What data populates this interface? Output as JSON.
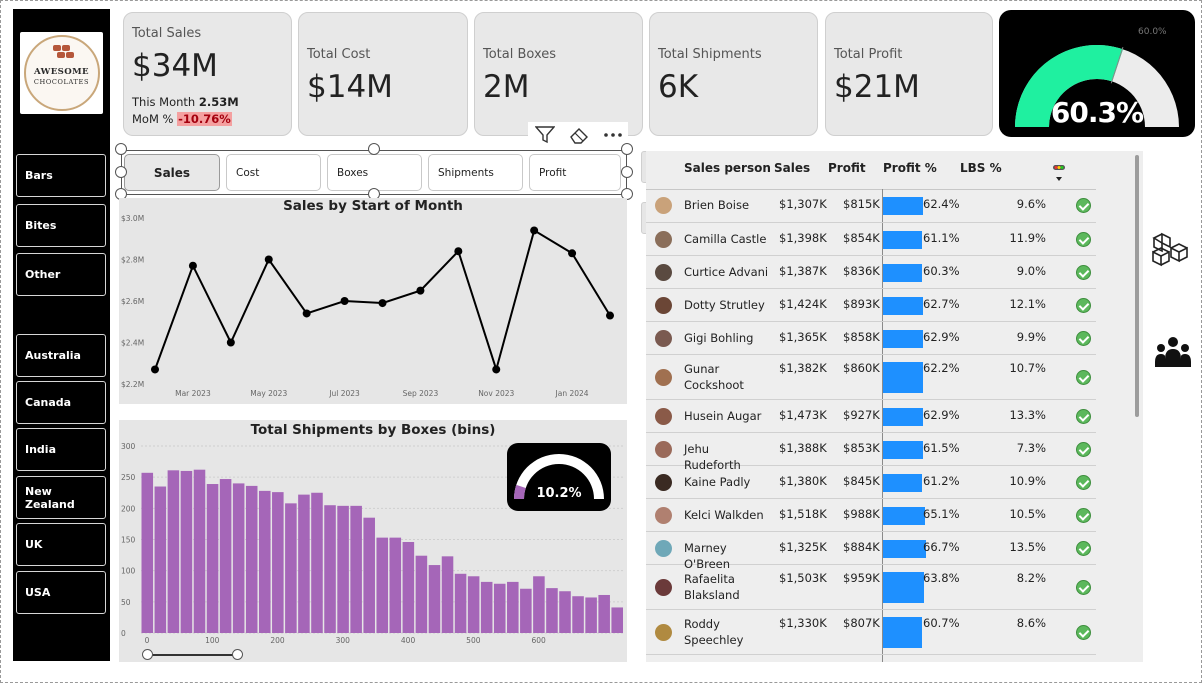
{
  "logo": {
    "line1": "AWESOME",
    "line2": "CHOCOLATES"
  },
  "sidebar": {
    "categories": [
      "Bars",
      "Bites",
      "Other"
    ],
    "countries": [
      "Australia",
      "Canada",
      "India",
      "New Zealand",
      "UK",
      "USA"
    ]
  },
  "kpis": {
    "sales": {
      "title": "Total Sales",
      "value": "$34M",
      "this_month_label": "This Month",
      "this_month_value": "2.53M",
      "mom_label": "MoM %",
      "mom_value": "-10.76%"
    },
    "cost": {
      "title": "Total Cost",
      "value": "$14M"
    },
    "boxes": {
      "title": "Total Boxes",
      "value": "2M"
    },
    "shipments": {
      "title": "Total Shipments",
      "value": "6K"
    },
    "profit": {
      "title": "Total Profit",
      "value": "$21M"
    }
  },
  "gauge": {
    "value_label": "60.3%",
    "target_label": "60.0%",
    "value": 60.3,
    "target": 60.0,
    "fill_color": "#1ff0a0",
    "track_color": "#ececec"
  },
  "slicer": {
    "tabs": [
      "Sales",
      "Cost",
      "Boxes",
      "Shipments",
      "Profit"
    ],
    "selected": "Sales"
  },
  "colors": {
    "line": "#000000",
    "bars": "#a566b8",
    "profit_bar": "#1e90ff",
    "mom_negative": "#f4a0a0",
    "check": "#5cb85c"
  },
  "line_chart": {
    "chart_data": {
      "type": "line",
      "title": "Sales by Start of Month",
      "x": [
        "2023-02",
        "2023-03",
        "2023-04",
        "2023-05",
        "2023-06",
        "2023-07",
        "2023-08",
        "2023-09",
        "2023-10",
        "2023-11",
        "2023-12",
        "2024-01",
        "2024-02"
      ],
      "values": [
        2.27,
        2.77,
        2.4,
        2.8,
        2.54,
        2.6,
        2.59,
        2.65,
        2.84,
        2.27,
        2.94,
        2.83,
        2.53
      ],
      "ylim": [
        2.2,
        3.0
      ],
      "y_ticks": [
        "$2.2M",
        "$2.4M",
        "$2.6M",
        "$2.8M",
        "$3.0M"
      ],
      "x_ticks": [
        "Mar 2023",
        "May 2023",
        "Jul 2023",
        "Sep 2023",
        "Nov 2023",
        "Jan 2024"
      ],
      "grid": false
    }
  },
  "histogram": {
    "chart_data": {
      "type": "bar",
      "title": "Total Shipments by Boxes (bins)",
      "bin_start": 0,
      "bin_width": 20,
      "values": [
        257,
        235,
        261,
        260,
        262,
        239,
        247,
        240,
        236,
        228,
        226,
        208,
        222,
        225,
        205,
        204,
        204,
        185,
        153,
        153,
        146,
        124,
        109,
        123,
        95,
        91,
        82,
        79,
        82,
        71,
        91,
        72,
        67,
        59,
        57,
        61,
        41
      ],
      "ylim": [
        0,
        300
      ],
      "y_ticks": [
        "0",
        "50",
        "100",
        "150",
        "200",
        "250",
        "300"
      ],
      "x_ticks": [
        "0",
        "100",
        "200",
        "300",
        "400",
        "500",
        "600"
      ],
      "grid": true
    }
  },
  "mini_gauge": {
    "value_label": "10.2%",
    "value": 10.2
  },
  "table": {
    "headers": {
      "person": "Sales person",
      "sales": "Sales",
      "profit": "Profit",
      "profit_pct": "Profit %",
      "lbs_pct": "LBS %"
    },
    "rows": [
      {
        "name": "Brien Boise",
        "sales": "$1,307K",
        "profit": "$815K",
        "profit_pct": "62.4%",
        "profit_pct_value": 62.4,
        "lbs": "9.6%"
      },
      {
        "name": "Camilla Castle",
        "sales": "$1,398K",
        "profit": "$854K",
        "profit_pct": "61.1%",
        "profit_pct_value": 61.1,
        "lbs": "11.9%"
      },
      {
        "name": "Curtice Advani",
        "sales": "$1,387K",
        "profit": "$836K",
        "profit_pct": "60.3%",
        "profit_pct_value": 60.3,
        "lbs": "9.0%"
      },
      {
        "name": "Dotty Strutley",
        "sales": "$1,424K",
        "profit": "$893K",
        "profit_pct": "62.7%",
        "profit_pct_value": 62.7,
        "lbs": "12.1%"
      },
      {
        "name": "Gigi Bohling",
        "sales": "$1,365K",
        "profit": "$858K",
        "profit_pct": "62.9%",
        "profit_pct_value": 62.9,
        "lbs": "9.9%"
      },
      {
        "name": "Gunar Cockshoot",
        "sales": "$1,382K",
        "profit": "$860K",
        "profit_pct": "62.2%",
        "profit_pct_value": 62.2,
        "lbs": "10.7%"
      },
      {
        "name": "Husein Augar",
        "sales": "$1,473K",
        "profit": "$927K",
        "profit_pct": "62.9%",
        "profit_pct_value": 62.9,
        "lbs": "13.3%"
      },
      {
        "name": "Jehu Rudeforth",
        "sales": "$1,388K",
        "profit": "$853K",
        "profit_pct": "61.5%",
        "profit_pct_value": 61.5,
        "lbs": "7.3%"
      },
      {
        "name": "Kaine Padly",
        "sales": "$1,380K",
        "profit": "$845K",
        "profit_pct": "61.2%",
        "profit_pct_value": 61.2,
        "lbs": "10.9%"
      },
      {
        "name": "Kelci Walkden",
        "sales": "$1,518K",
        "profit": "$988K",
        "profit_pct": "65.1%",
        "profit_pct_value": 65.1,
        "lbs": "10.5%"
      },
      {
        "name": "Marney O'Breen",
        "sales": "$1,325K",
        "profit": "$884K",
        "profit_pct": "66.7%",
        "profit_pct_value": 66.7,
        "lbs": "13.5%"
      },
      {
        "name": "Rafaelita Blaksland",
        "sales": "$1,503K",
        "profit": "$959K",
        "profit_pct": "63.8%",
        "profit_pct_value": 63.8,
        "lbs": "8.2%"
      },
      {
        "name": "Roddy Speechley",
        "sales": "$1,330K",
        "profit": "$807K",
        "profit_pct": "60.7%",
        "profit_pct_value": 60.7,
        "lbs": "8.6%"
      }
    ]
  },
  "icons": {
    "filter": "filter-icon",
    "eraser": "eraser-icon",
    "more": "more-options-icon",
    "bar_chart": "bar-chart-icon",
    "format": "format-paintbrush-icon",
    "boxes": "boxes-icon",
    "people": "people-icon",
    "sort": "sort-indicator-icon"
  }
}
